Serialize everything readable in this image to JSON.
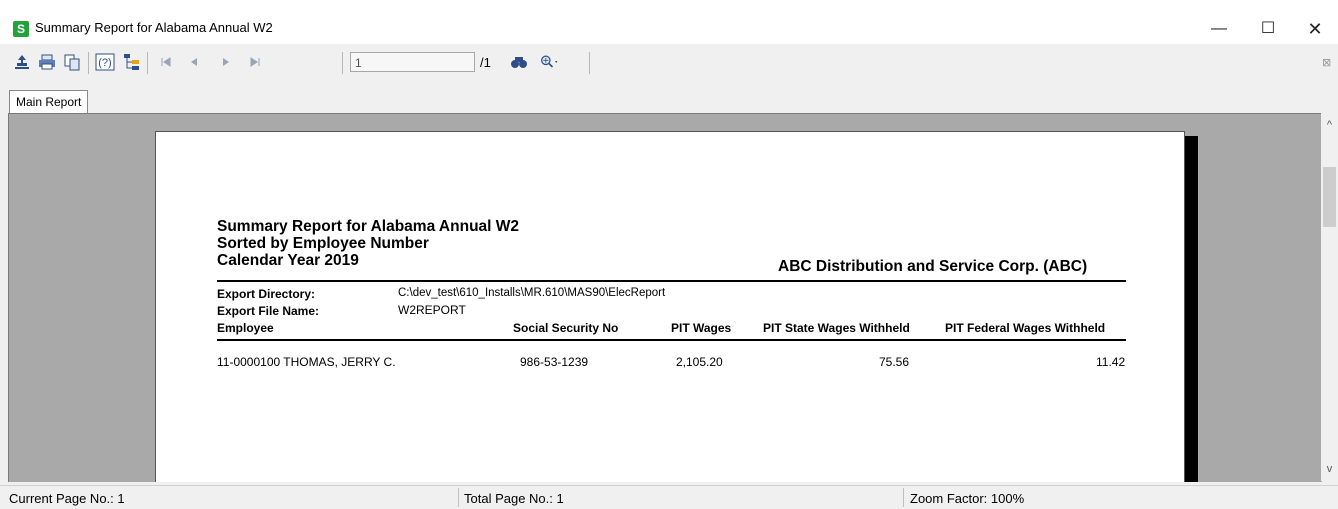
{
  "window": {
    "icon_letter": "S",
    "title": "Summary Report for Alabama Annual W2",
    "minimize": "—",
    "maximize": "☐",
    "close": "✕"
  },
  "toolbar": {
    "page_input": "1",
    "page_total": "/1",
    "close_glyph": "⊠",
    "icons": [
      "export-icon",
      "print-icon",
      "copy-icon",
      "help-icon",
      "group-tree-icon",
      "first-page-icon",
      "prev-page-icon",
      "next-page-icon",
      "last-page-icon",
      "find-icon",
      "zoom-icon"
    ]
  },
  "tabs": [
    {
      "label": "Main Report"
    }
  ],
  "report": {
    "title": "Summary Report for Alabama Annual W2",
    "subtitle": "Sorted by Employee Number",
    "year": "Calendar Year 2019",
    "company": "ABC Distribution and Service Corp. (ABC)",
    "export_dir_label": "Export Directory:",
    "export_dir_value": "C:\\dev_test\\610_Installs\\MR.610\\MAS90\\ElecReport",
    "export_file_label": "Export File Name:",
    "export_file_value": "W2REPORT",
    "columns": [
      "Employee",
      "Social Security No",
      "PIT Wages",
      "PIT State Wages Withheld",
      "PIT Federal Wages Withheld"
    ],
    "rows": [
      {
        "employee": "11-0000100  THOMAS, JERRY C.",
        "ssn": "986-53-1239",
        "pit_wages": "2,105.20",
        "state_withheld": "75.56",
        "federal_withheld": "11.42"
      }
    ]
  },
  "status": {
    "current_page": "Current Page No.: 1",
    "total_page": "Total Page No.: 1",
    "zoom": "Zoom Factor: 100%"
  }
}
